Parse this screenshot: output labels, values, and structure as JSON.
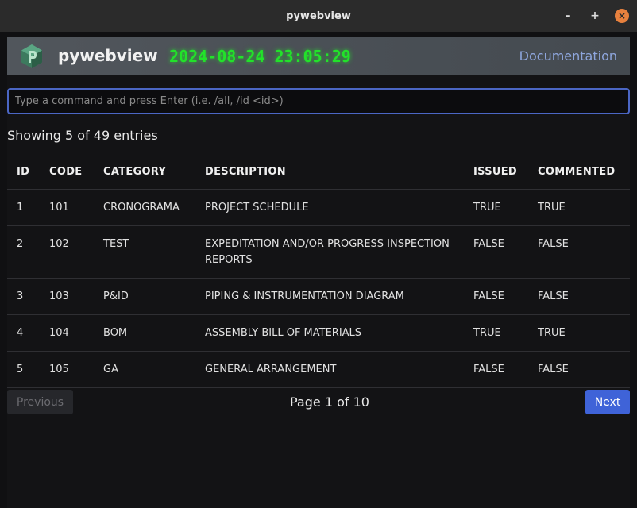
{
  "window": {
    "title": "pywebview",
    "minimize_glyph": "–",
    "maximize_glyph": "+",
    "close_glyph": "×"
  },
  "header": {
    "logo_icon": "pywebview-logo-icon",
    "app_name": "pywebview",
    "clock": "2024-08-24 23:05:29",
    "doc_link": "Documentation",
    "clock_color": "#22e22a"
  },
  "command": {
    "placeholder": "Type a command and press Enter (i.e. /all, /id <id>)",
    "value": ""
  },
  "summary": "Showing 5 of 49 entries",
  "table": {
    "columns": [
      "ID",
      "CODE",
      "CATEGORY",
      "DESCRIPTION",
      "ISSUED",
      "COMMENTED"
    ],
    "rows": [
      [
        "1",
        "101",
        "CRONOGRAMA",
        "PROJECT SCHEDULE",
        "TRUE",
        "TRUE"
      ],
      [
        "2",
        "102",
        "TEST",
        "EXPEDITATION AND/OR PROGRESS INSPECTION REPORTS",
        "FALSE",
        "FALSE"
      ],
      [
        "3",
        "103",
        "P&ID",
        "PIPING & INSTRUMENTATION DIAGRAM",
        "FALSE",
        "FALSE"
      ],
      [
        "4",
        "104",
        "BOM",
        "ASSEMBLY BILL OF MATERIALS",
        "TRUE",
        "TRUE"
      ],
      [
        "5",
        "105",
        "GA",
        "GENERAL ARRANGEMENT",
        "FALSE",
        "FALSE"
      ]
    ]
  },
  "pagination": {
    "previous_label": "Previous",
    "page_info": "Page 1 of 10",
    "next_label": "Next"
  },
  "colors": {
    "accent": "#3f63d8",
    "close_button": "#e8813e"
  }
}
